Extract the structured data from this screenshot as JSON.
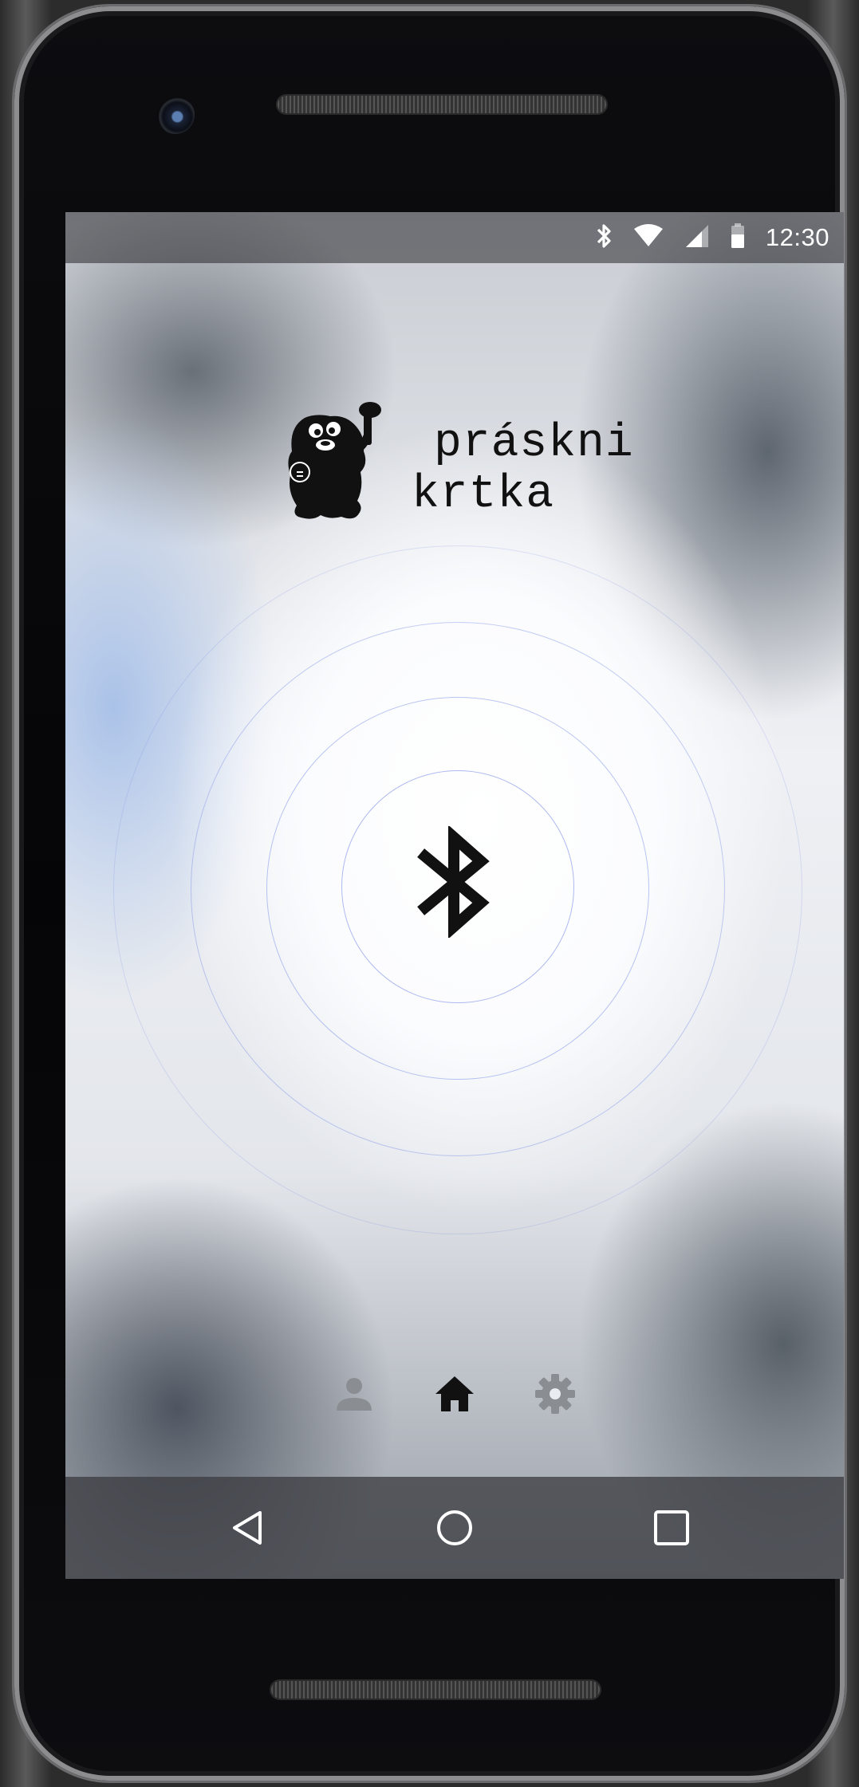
{
  "status_bar": {
    "time": "12:30",
    "icons": [
      "bluetooth-icon",
      "wifi-icon",
      "cell-signal-icon",
      "battery-icon"
    ],
    "text_color": "#ffffff"
  },
  "app": {
    "logo_line1": "práskni",
    "logo_line2": "krtka",
    "center_icon": "bluetooth-icon",
    "ring_color": "#6e82e6"
  },
  "bottom_tabs": [
    {
      "icon": "person-icon",
      "active": false
    },
    {
      "icon": "home-icon",
      "active": true
    },
    {
      "icon": "gear-icon",
      "active": false
    }
  ],
  "nav_bar": {
    "icons": [
      "back-icon",
      "home-circle-icon",
      "recents-square-icon"
    ]
  },
  "colors": {
    "active_tab": "#111111",
    "inactive_tab": "#8a8d92"
  }
}
